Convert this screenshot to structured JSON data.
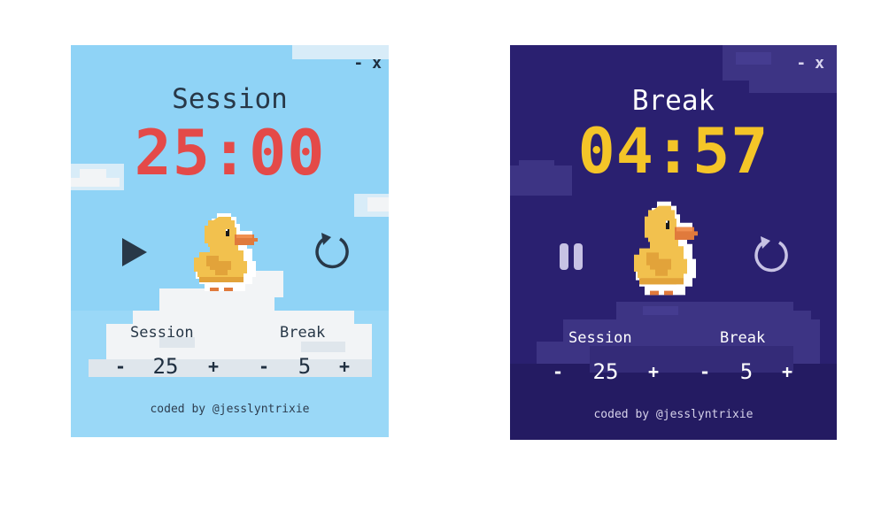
{
  "widgets": [
    {
      "theme": "light",
      "window_controls": {
        "minimize": "-",
        "close": "x"
      },
      "mode_label": "Session",
      "timer": "25:00",
      "play_control": "play-icon",
      "reset_control": "reset-icon",
      "session": {
        "label": "Session",
        "value": "25",
        "minus": "-",
        "plus": "+"
      },
      "break": {
        "label": "Break",
        "value": "5",
        "minus": "-",
        "plus": "+"
      },
      "credit": "coded by @jesslyntrixie",
      "colors": {
        "background": "#8fd3f6",
        "timer": "#e44a48",
        "text": "#283848"
      }
    },
    {
      "theme": "dark",
      "window_controls": {
        "minimize": "-",
        "close": "x"
      },
      "mode_label": "Break",
      "timer": "04:57",
      "play_control": "pause-icon",
      "reset_control": "reset-icon",
      "session": {
        "label": "Session",
        "value": "25",
        "minus": "-",
        "plus": "+"
      },
      "break": {
        "label": "Break",
        "value": "5",
        "minus": "-",
        "plus": "+"
      },
      "credit": "coded by @jesslyntrixie",
      "colors": {
        "background": "#2a2070",
        "timer": "#f4c528",
        "text": "#ffffff"
      }
    }
  ]
}
